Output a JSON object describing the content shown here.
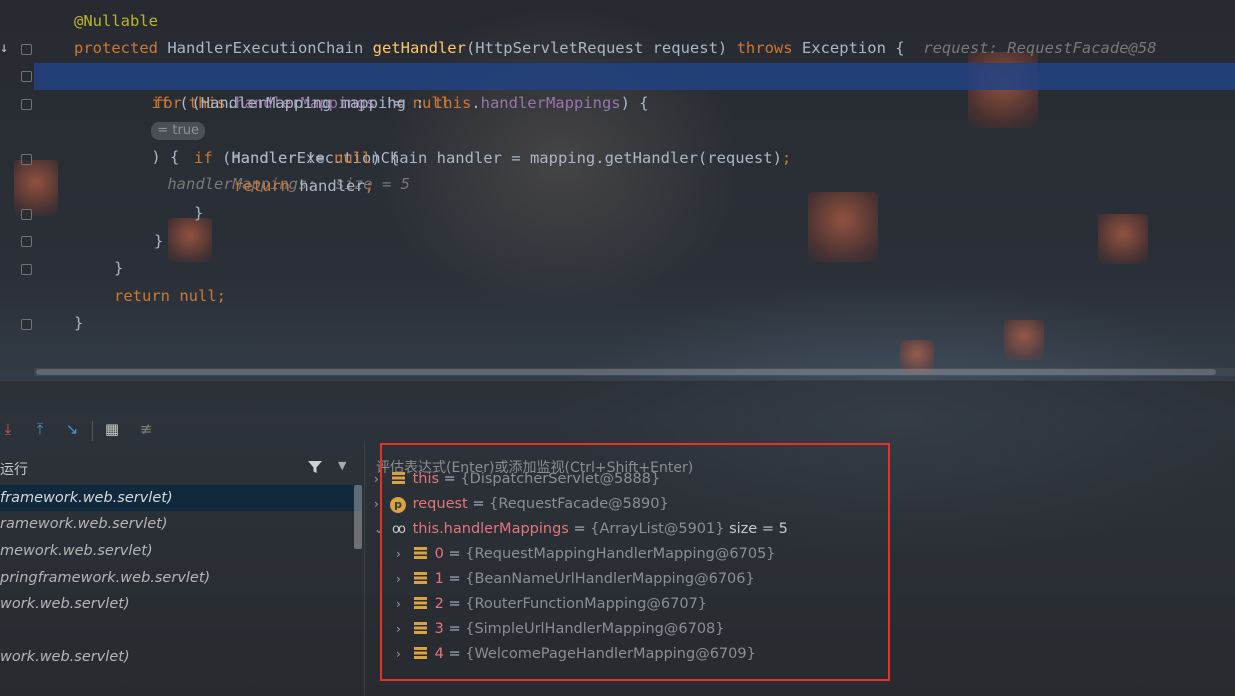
{
  "editor": {
    "lines": [
      {
        "id": "l1",
        "segments": [
          {
            "t": "@Nullable",
            "c": "ann"
          }
        ]
      },
      {
        "id": "l2",
        "segments": [
          {
            "t": "protected ",
            "c": "kw"
          },
          {
            "t": "HandlerExecutionChain "
          },
          {
            "t": "getHandler",
            "c": "fn"
          },
          {
            "t": "(HttpServletRequest request) "
          },
          {
            "t": "throws ",
            "c": "kw"
          },
          {
            "t": "Exception {  "
          },
          {
            "t": "request: RequestFacade@58",
            "c": "hint"
          }
        ]
      },
      {
        "id": "l3",
        "segments": [
          {
            "t": "if ",
            "c": "kw"
          },
          {
            "t": "("
          },
          {
            "t": "this",
            "c": "kw"
          },
          {
            "t": "."
          },
          {
            "t": "handlerMappings",
            "c": "fld"
          },
          {
            "t": " != "
          },
          {
            "t": "null",
            "c": "kw"
          }
        ]
      },
      {
        "id": "l4",
        "segments": [
          {
            "t": "for ",
            "c": "kw"
          },
          {
            "t": "(HandlerMapping mapping : "
          },
          {
            "t": "this",
            "c": "kw"
          },
          {
            "t": "."
          },
          {
            "t": "handlerMappings",
            "c": "fld"
          },
          {
            "t": ") {"
          }
        ]
      },
      {
        "id": "l5",
        "segments": [
          {
            "t": "HandlerExecutionChain handler = mapping.getHandler(request)"
          },
          {
            "t": ";",
            "c": "kw"
          }
        ]
      },
      {
        "id": "l6",
        "segments": [
          {
            "t": "if ",
            "c": "kw"
          },
          {
            "t": "(handler != "
          },
          {
            "t": "null",
            "c": "kw"
          },
          {
            "t": ") {"
          }
        ]
      },
      {
        "id": "l7",
        "segments": [
          {
            "t": "return ",
            "c": "kw"
          },
          {
            "t": "handler"
          },
          {
            "t": ";",
            "c": "kw"
          }
        ]
      },
      {
        "id": "l8",
        "segments": [
          {
            "t": "}"
          }
        ]
      },
      {
        "id": "l9",
        "segments": [
          {
            "t": "}"
          }
        ]
      },
      {
        "id": "l10",
        "segments": [
          {
            "t": "}"
          }
        ]
      },
      {
        "id": "l11",
        "segments": [
          {
            "t": "return null",
            "c": "kw"
          },
          {
            "t": ";",
            "c": "kw"
          }
        ]
      },
      {
        "id": "l12",
        "segments": [
          {
            "t": "}"
          }
        ]
      }
    ],
    "inlay_true": "= true",
    "line3_tail": ") {",
    "line3_hint": "handlerMappings:  size = 5"
  },
  "frames": {
    "title": "运行",
    "items": [
      "framework.web.servlet)",
      "ramework.web.servlet)",
      "mework.web.servlet)",
      "pringframework.web.servlet)",
      "work.web.servlet)",
      "",
      "work.web.servlet)"
    ]
  },
  "variables": {
    "eval_placeholder": "评估表达式(Enter)或添加监视(Ctrl+Shift+Enter)",
    "rows": [
      {
        "name": "this",
        "value": "{DispatcherServlet@5888}",
        "icon": "field-icon",
        "expanded": false,
        "child": false
      },
      {
        "name": "request",
        "value": "{RequestFacade@5890}",
        "icon": "parameter-icon",
        "expanded": false,
        "child": false
      },
      {
        "name": "this.handlerMappings",
        "value": "{ArrayList@5901}",
        "extra": "size = 5",
        "icon": "watch-glasses-icon",
        "expanded": true,
        "child": false
      },
      {
        "name": "0",
        "value": "{RequestMappingHandlerMapping@6705}",
        "icon": "field-icon",
        "expanded": false,
        "child": true
      },
      {
        "name": "1",
        "value": "{BeanNameUrlHandlerMapping@6706}",
        "icon": "field-icon",
        "expanded": false,
        "child": true
      },
      {
        "name": "2",
        "value": "{RouterFunctionMapping@6707}",
        "icon": "field-icon",
        "expanded": false,
        "child": true
      },
      {
        "name": "3",
        "value": "{SimpleUrlHandlerMapping@6708}",
        "icon": "field-icon",
        "expanded": false,
        "child": true
      },
      {
        "name": "4",
        "value": "{WelcomePageHandlerMapping@6709}",
        "icon": "field-icon",
        "expanded": false,
        "child": true
      }
    ]
  },
  "colors": {
    "highlight_row": "#214283",
    "annotation_box": "#e5312b",
    "keyword": "#cc7832",
    "method": "#ffc66d",
    "field": "#9876aa"
  }
}
